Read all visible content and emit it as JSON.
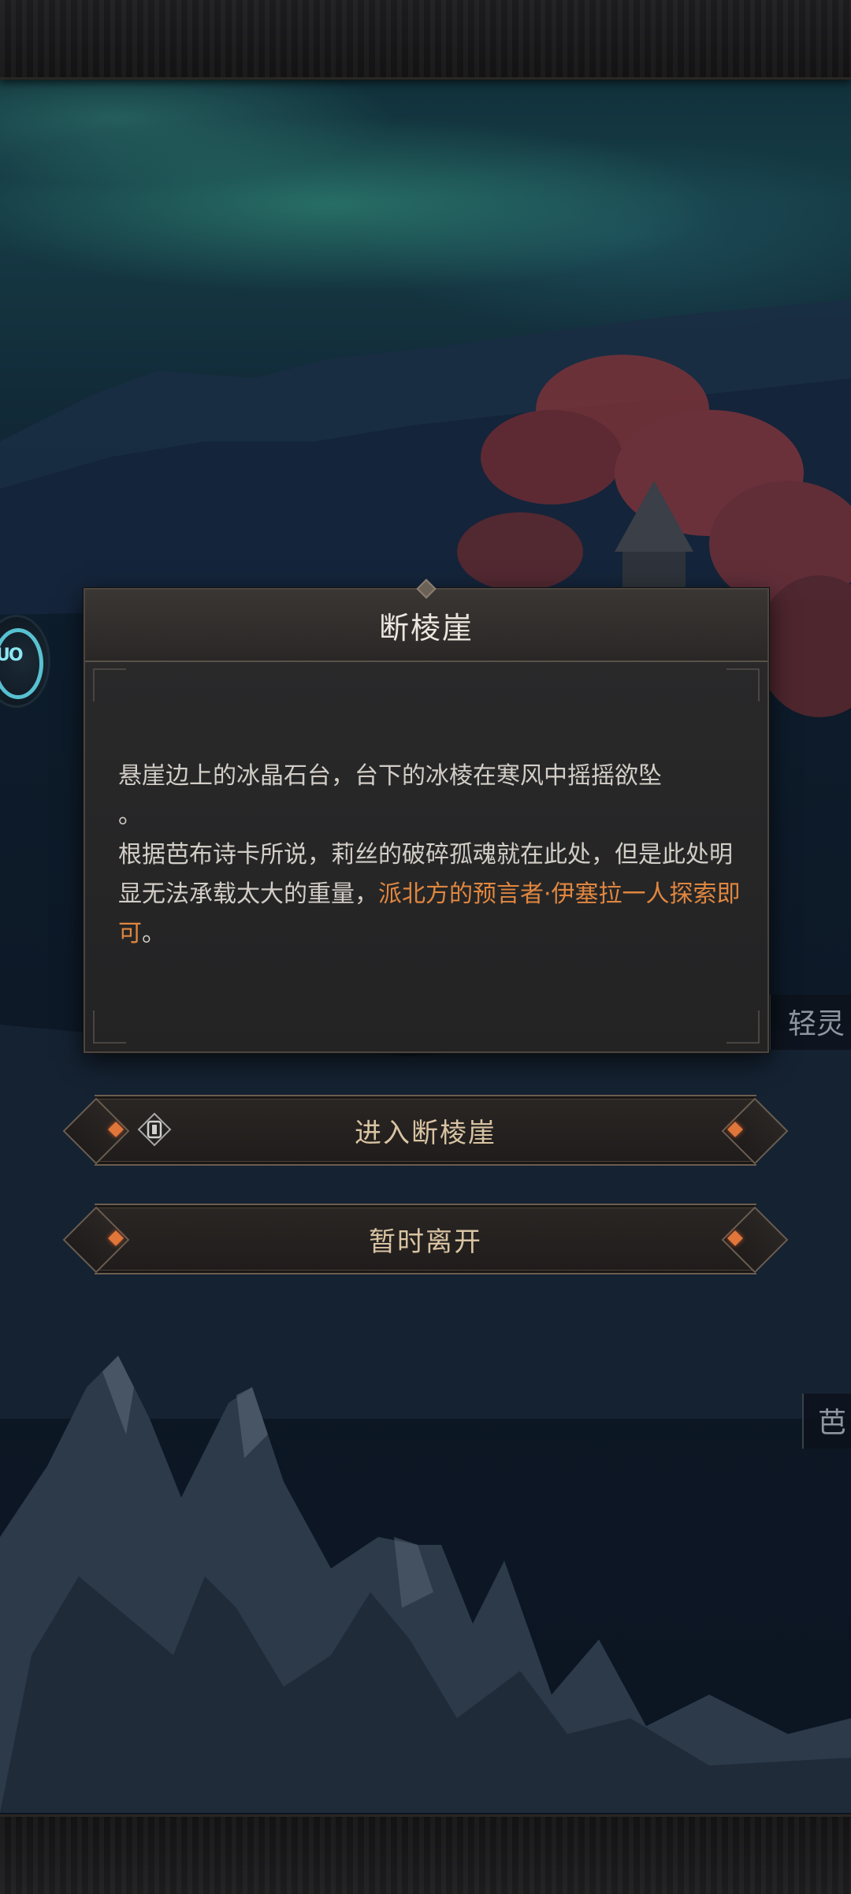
{
  "dialog": {
    "title": "断棱崖",
    "line1": "悬崖边上的冰晶石台，台下的冰棱在寒风中摇摇欲坠",
    "line1_end": "。",
    "line2_a": "根据芭布诗卡所说，莉丝的破碎孤魂就在此处，但是此处明显无法承载太大的重量，",
    "line2_highlight": "派北方的预言者·伊塞拉一人探索即可",
    "line2_end": "。"
  },
  "buttons": {
    "enter_label": "进入断棱崖",
    "leave_label": "暂时离开"
  },
  "side_labels": {
    "label_a": "轻灵",
    "label_b": "芭"
  },
  "avatar": {
    "text": "UO"
  },
  "colors": {
    "highlight": "#e0863f",
    "accent_dot": "#e0763a"
  }
}
